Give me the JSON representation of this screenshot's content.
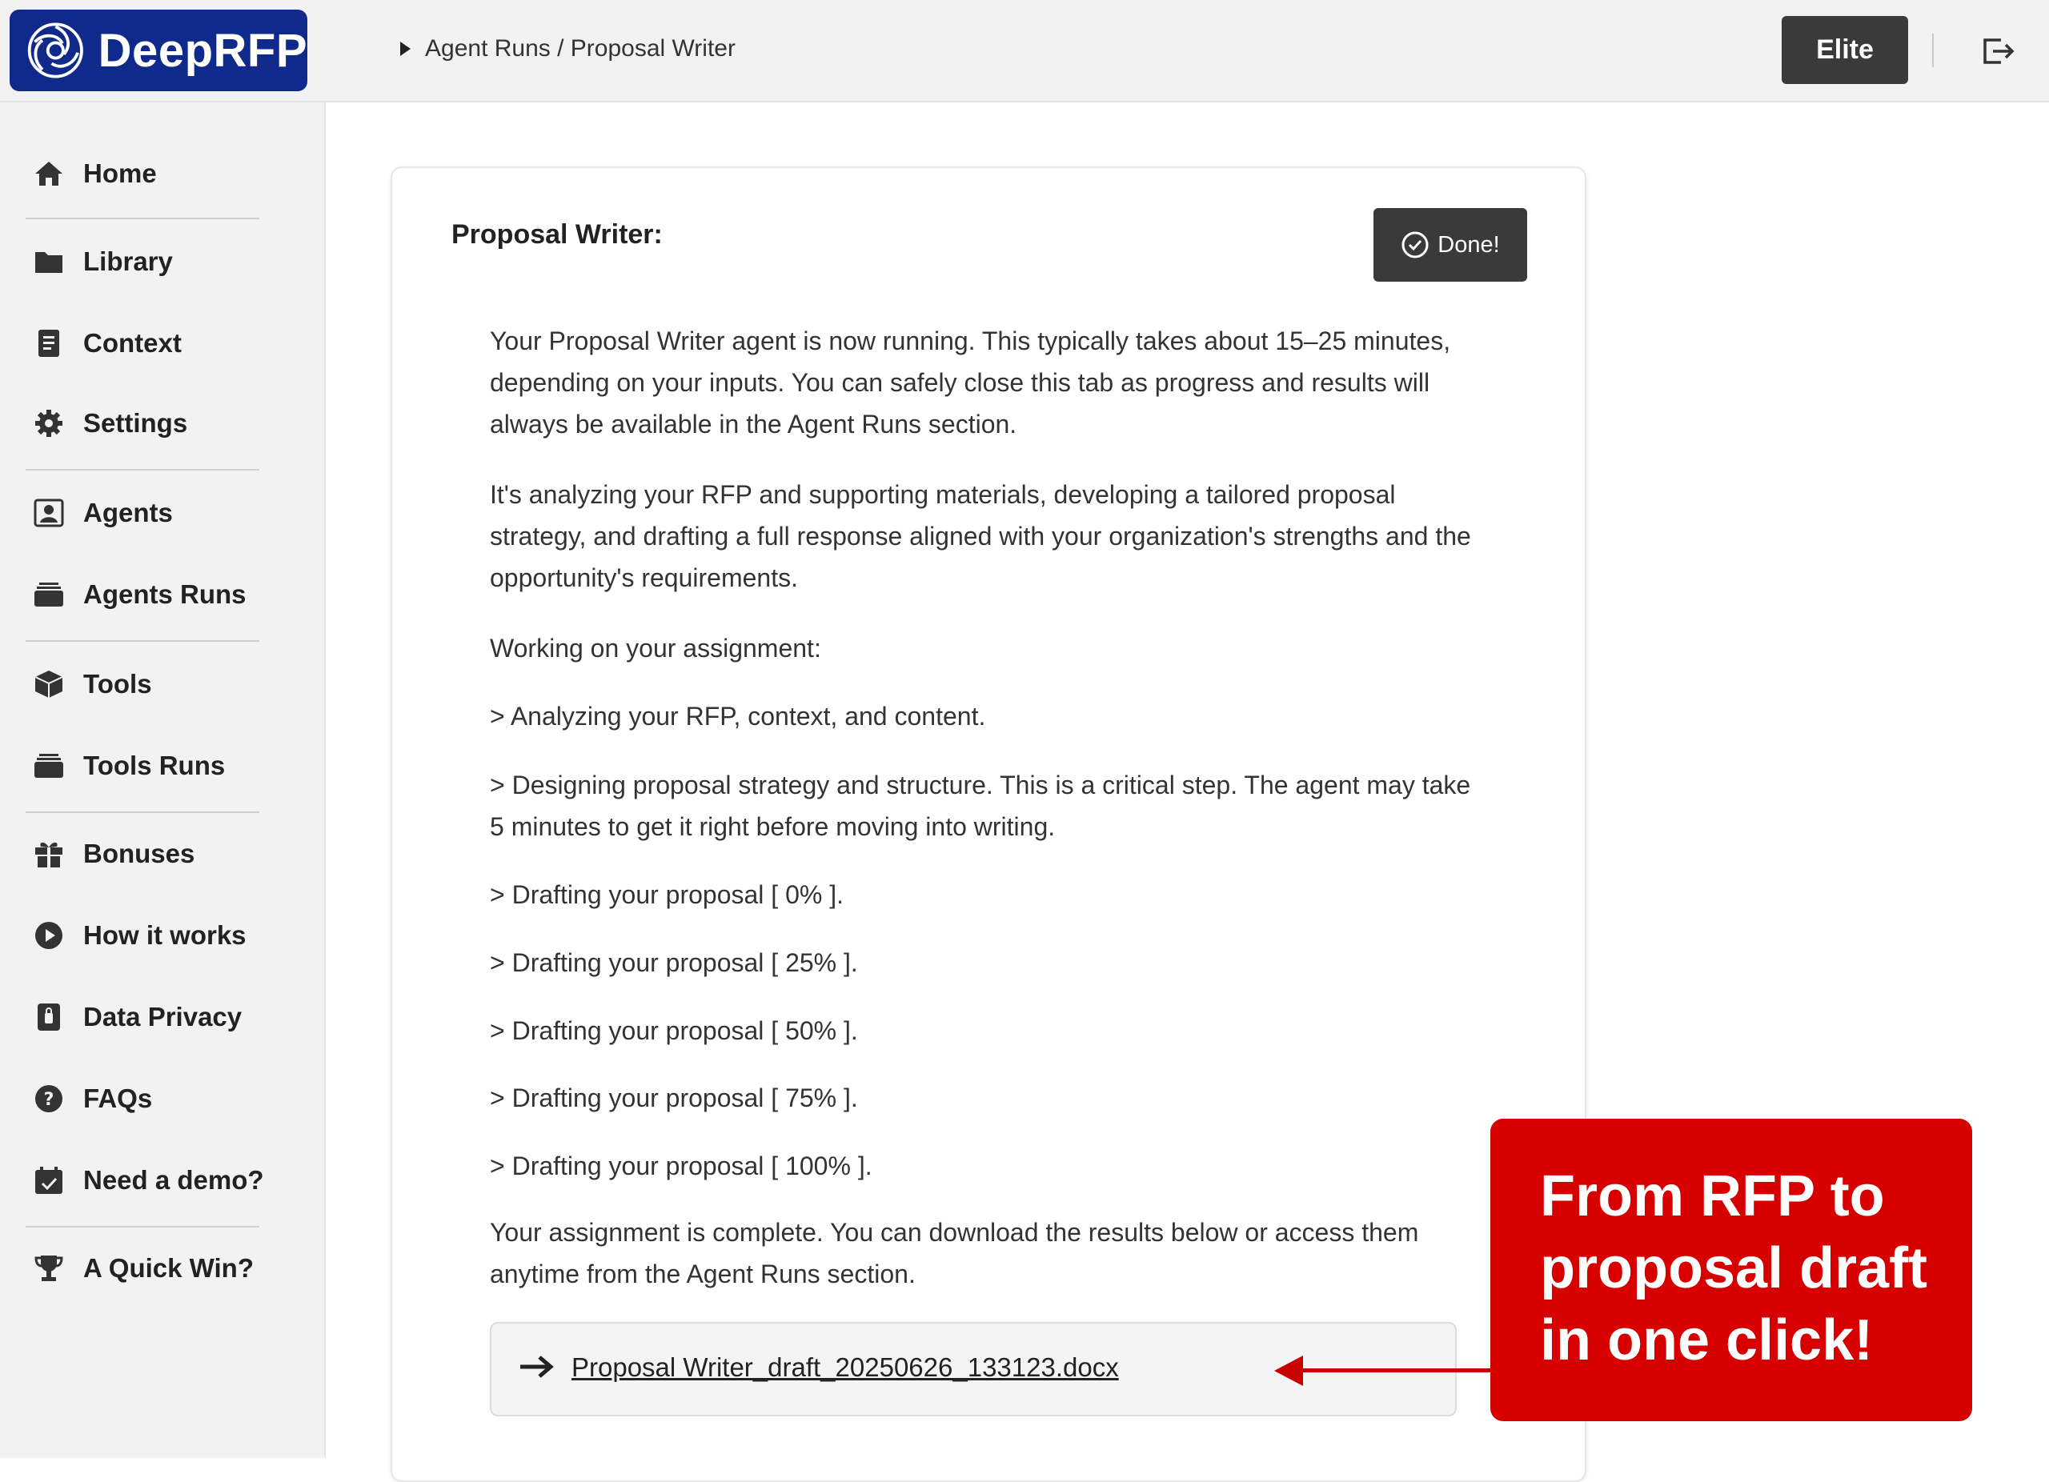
{
  "app": {
    "brand": "DeepRFP",
    "brand_color": "#102a8c"
  },
  "header": {
    "breadcrumb": "Agent Runs / Proposal Writer",
    "plan_label": "Elite"
  },
  "sidebar": {
    "items": [
      {
        "label": "Home",
        "icon": "home-icon"
      },
      {
        "label": "Library",
        "icon": "folder-icon"
      },
      {
        "label": "Context",
        "icon": "document-icon"
      },
      {
        "label": "Settings",
        "icon": "gear-icon"
      },
      {
        "label": "Agents",
        "icon": "agent-icon"
      },
      {
        "label": "Agents Runs",
        "icon": "stack-icon"
      },
      {
        "label": "Tools",
        "icon": "box-icon"
      },
      {
        "label": "Tools Runs",
        "icon": "stack-icon"
      },
      {
        "label": "Bonuses",
        "icon": "gift-icon"
      },
      {
        "label": "How it works",
        "icon": "play-icon"
      },
      {
        "label": "Data Privacy",
        "icon": "lock-icon"
      },
      {
        "label": "FAQs",
        "icon": "question-icon"
      },
      {
        "label": "Need a demo?",
        "icon": "calendar-icon"
      },
      {
        "label": "A Quick Win?",
        "icon": "trophy-icon"
      }
    ]
  },
  "main": {
    "title": "Proposal Writer:",
    "done_label": "Done!",
    "paragraphs": [
      "Your Proposal Writer agent is now running. This typically takes about 15–25 minutes, depending on your inputs. You can safely close this tab as progress and results will always be available in the Agent Runs section.",
      "It's analyzing your RFP and supporting materials, developing a tailored proposal strategy, and drafting a full response aligned with your organization's strengths and the opportunity's requirements.",
      "Working on your assignment:",
      "> Analyzing your RFP, context, and content.",
      "> Designing proposal strategy and structure. This is a critical step. The agent may take 5 minutes to get it right before moving into writing.",
      "> Drafting your proposal [ 0% ].",
      "> Drafting your proposal [ 25% ].",
      "> Drafting your proposal [ 50% ].",
      "> Drafting your proposal [ 75% ].",
      "> Drafting your proposal [ 100% ].",
      "Your assignment is complete. You can download the results below or access them anytime from the Agent Runs section."
    ],
    "download_file": "Proposal Writer_draft_20250626_133123.docx"
  },
  "callout": {
    "text": "From RFP to proposal draft in one click!",
    "color": "#d60000"
  }
}
